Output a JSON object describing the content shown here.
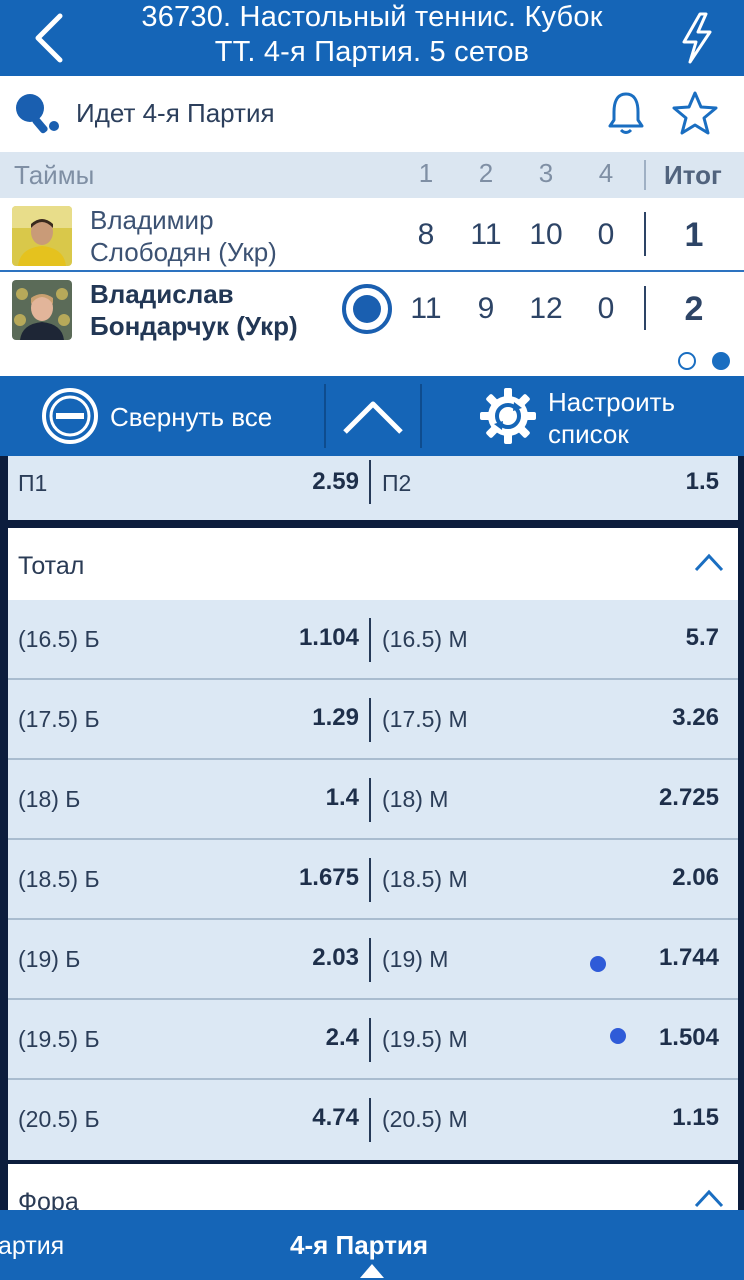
{
  "header": {
    "title_line1": "36730. Настольный теннис. Кубок",
    "title_line2": "ТТ. 4-я  Партия. 5 сетов",
    "back_icon": "chevron-left-icon",
    "action_icon": "lightning-icon"
  },
  "status": {
    "text": "Идет 4-я  Партия",
    "icons": [
      "ping-pong-icon",
      "bell-icon",
      "star-icon"
    ]
  },
  "scoreboard": {
    "header_label": "Таймы",
    "columns": [
      "1",
      "2",
      "3",
      "4"
    ],
    "total_label": "Итог",
    "players": [
      {
        "name_line1": "Владимир",
        "name_line2": "Слободян (Укр)",
        "scores": [
          "8",
          "11",
          "10",
          "0"
        ],
        "total": "1",
        "serving": false
      },
      {
        "name_line1": "Владислав",
        "name_line2": "Бондарчук (Укр)",
        "scores": [
          "11",
          "9",
          "12",
          "0"
        ],
        "total": "2",
        "serving": true
      }
    ]
  },
  "toolbar": {
    "collapse_label": "Свернуть все",
    "settings_line1": "Настроить",
    "settings_line2": "список"
  },
  "winner_market": {
    "left_name": "П1",
    "left_odd": "2.59",
    "right_name": "П2",
    "right_odd": "1.5"
  },
  "total_market": {
    "title": "Тотал",
    "rows": [
      {
        "over": "(16.5) Б",
        "over_odd": "1.104",
        "under": "(16.5) М",
        "under_odd": "5.7"
      },
      {
        "over": "(17.5) Б",
        "over_odd": "1.29",
        "under": "(17.5) М",
        "under_odd": "3.26"
      },
      {
        "over": "(18) Б",
        "over_odd": "1.4",
        "under": "(18) М",
        "under_odd": "2.725"
      },
      {
        "over": "(18.5) Б",
        "over_odd": "1.675",
        "under": "(18.5) М",
        "under_odd": "2.06"
      },
      {
        "over": "(19) Б",
        "over_odd": "2.03",
        "under": "(19) М",
        "under_odd": "1.744"
      },
      {
        "over": "(19.5) Б",
        "over_odd": "2.4",
        "under": "(19.5) М",
        "under_odd": "1.504"
      },
      {
        "over": "(20.5) Б",
        "over_odd": "4.74",
        "under": "(20.5) М",
        "under_odd": "1.15"
      }
    ]
  },
  "handicap_market": {
    "title": "Фора"
  },
  "bottom_nav": {
    "prev_label": "артия",
    "current_label": "4-я  Партия"
  },
  "colors": {
    "primary": "#1565b7",
    "background_dark": "#0c1d3d",
    "row_bg": "#dce8f4"
  }
}
